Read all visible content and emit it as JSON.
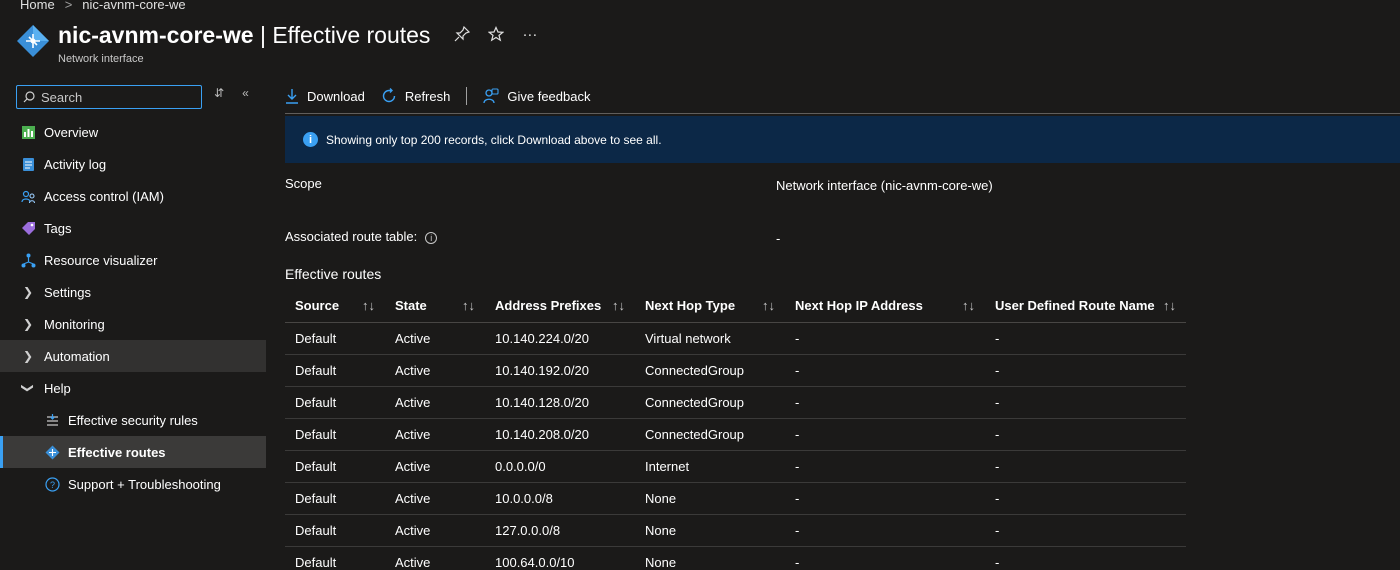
{
  "breadcrumb": {
    "home": "Home",
    "separator": ">",
    "current": "nic-avnm-core-we"
  },
  "header": {
    "resource_name": "nic-avnm-core-we",
    "divider": " | ",
    "page_name": "Effective routes",
    "subtitle": "Network interface",
    "pin_icon": "pin-icon",
    "star_icon": "star-icon",
    "more_label": "···"
  },
  "sidebar": {
    "search_placeholder": "Search",
    "items": [
      {
        "label": "Overview",
        "icon": "overview-icon"
      },
      {
        "label": "Activity log",
        "icon": "activity-log-icon"
      },
      {
        "label": "Access control (IAM)",
        "icon": "iam-icon"
      },
      {
        "label": "Tags",
        "icon": "tag-icon"
      },
      {
        "label": "Resource visualizer",
        "icon": "visualizer-icon"
      },
      {
        "label": "Settings",
        "icon": "chevron-right-icon"
      },
      {
        "label": "Monitoring",
        "icon": "chevron-right-icon"
      },
      {
        "label": "Automation",
        "icon": "chevron-right-icon"
      },
      {
        "label": "Help",
        "icon": "chevron-down-icon"
      },
      {
        "label": "Effective security rules",
        "icon": "security-rules-icon"
      },
      {
        "label": "Effective routes",
        "icon": "routes-icon"
      },
      {
        "label": "Support + Troubleshooting",
        "icon": "support-icon"
      }
    ]
  },
  "toolbar": {
    "download_label": "Download",
    "refresh_label": "Refresh",
    "feedback_label": "Give feedback"
  },
  "banner": {
    "text": "Showing only top 200 records, click Download above to see all."
  },
  "properties": {
    "scope_label": "Scope",
    "scope_value": "Network interface (nic-avnm-core-we)",
    "route_table_label": "Associated route table:",
    "route_table_value": "-"
  },
  "routes": {
    "section_title": "Effective routes",
    "columns": [
      "Source",
      "State",
      "Address Prefixes",
      "Next Hop Type",
      "Next Hop IP Address",
      "User Defined Route Name"
    ],
    "sort_glyph": "↑↓",
    "rows": [
      [
        "Default",
        "Active",
        "10.140.224.0/20",
        "Virtual network",
        "-",
        "-"
      ],
      [
        "Default",
        "Active",
        "10.140.192.0/20",
        "ConnectedGroup",
        "-",
        "-"
      ],
      [
        "Default",
        "Active",
        "10.140.128.0/20",
        "ConnectedGroup",
        "-",
        "-"
      ],
      [
        "Default",
        "Active",
        "10.140.208.0/20",
        "ConnectedGroup",
        "-",
        "-"
      ],
      [
        "Default",
        "Active",
        "0.0.0.0/0",
        "Internet",
        "-",
        "-"
      ],
      [
        "Default",
        "Active",
        "10.0.0.0/8",
        "None",
        "-",
        "-"
      ],
      [
        "Default",
        "Active",
        "127.0.0.0/8",
        "None",
        "-",
        "-"
      ],
      [
        "Default",
        "Active",
        "100.64.0.0/10",
        "None",
        "-",
        "-"
      ]
    ]
  },
  "colors": {
    "accent": "#3aa0f3",
    "background": "#1b1a19",
    "banner": "#0c2847",
    "selected": "#3b3a39"
  }
}
